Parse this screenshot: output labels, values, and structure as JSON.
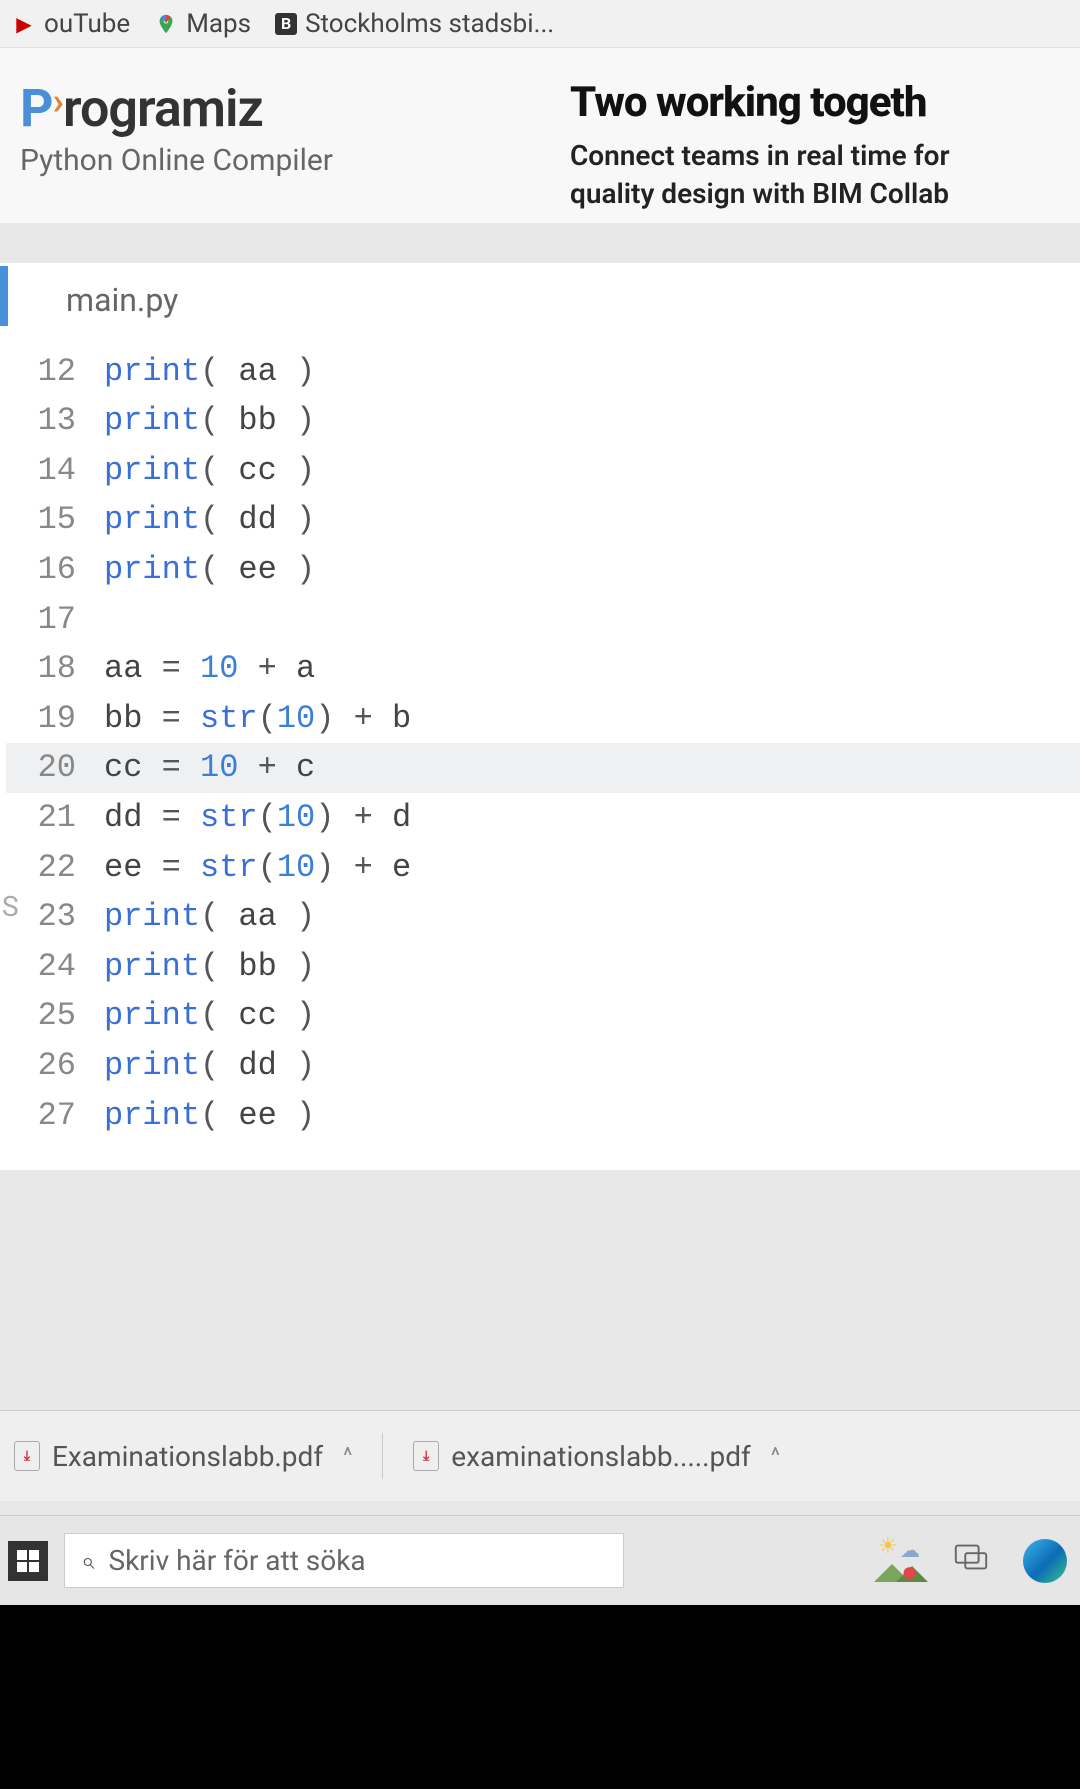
{
  "bookmarks": {
    "youtube_label": "ouTube",
    "maps_label": "Maps",
    "stockholms_label": "Stockholms stadsbi...",
    "stockholms_badge": "B"
  },
  "site": {
    "logo_rest": "rogramiz",
    "subtitle": "Python Online Compiler"
  },
  "ad": {
    "title": "Two working togeth",
    "line1": "Connect teams in real time for",
    "line2": "quality design with BIM Collab"
  },
  "editor": {
    "filename": "main.py",
    "lines": [
      {
        "n": "12",
        "tokens": [
          [
            "fn",
            "print"
          ],
          [
            "op",
            "( "
          ],
          [
            "var",
            "aa"
          ],
          [
            "op",
            " )"
          ]
        ]
      },
      {
        "n": "13",
        "tokens": [
          [
            "fn",
            "print"
          ],
          [
            "op",
            "( "
          ],
          [
            "var",
            "bb"
          ],
          [
            "op",
            " )"
          ]
        ]
      },
      {
        "n": "14",
        "tokens": [
          [
            "fn",
            "print"
          ],
          [
            "op",
            "( "
          ],
          [
            "var",
            "cc"
          ],
          [
            "op",
            " )"
          ]
        ]
      },
      {
        "n": "15",
        "tokens": [
          [
            "fn",
            "print"
          ],
          [
            "op",
            "( "
          ],
          [
            "var",
            "dd"
          ],
          [
            "op",
            " )"
          ]
        ]
      },
      {
        "n": "16",
        "tokens": [
          [
            "fn",
            "print"
          ],
          [
            "op",
            "( "
          ],
          [
            "var",
            "ee"
          ],
          [
            "op",
            " )"
          ]
        ]
      },
      {
        "n": "17",
        "tokens": []
      },
      {
        "n": "18",
        "tokens": [
          [
            "var",
            "aa "
          ],
          [
            "op",
            "= "
          ],
          [
            "num",
            "10"
          ],
          [
            "op",
            " + "
          ],
          [
            "var",
            "a"
          ]
        ]
      },
      {
        "n": "19",
        "tokens": [
          [
            "var",
            "bb "
          ],
          [
            "op",
            "= "
          ],
          [
            "fn",
            "str"
          ],
          [
            "op",
            "("
          ],
          [
            "num",
            "10"
          ],
          [
            "op",
            ") + "
          ],
          [
            "var",
            "b"
          ]
        ]
      },
      {
        "n": "20",
        "hl": true,
        "tokens": [
          [
            "var",
            "cc "
          ],
          [
            "op",
            "= "
          ],
          [
            "num",
            "10"
          ],
          [
            "op",
            " + "
          ],
          [
            "var",
            "c"
          ]
        ]
      },
      {
        "n": "21",
        "tokens": [
          [
            "var",
            "dd "
          ],
          [
            "op",
            "= "
          ],
          [
            "fn",
            "str"
          ],
          [
            "op",
            "("
          ],
          [
            "num",
            "10"
          ],
          [
            "op",
            ") + "
          ],
          [
            "var",
            "d"
          ]
        ]
      },
      {
        "n": "22",
        "tokens": [
          [
            "var",
            "ee "
          ],
          [
            "op",
            "= "
          ],
          [
            "fn",
            "str"
          ],
          [
            "op",
            "("
          ],
          [
            "num",
            "10"
          ],
          [
            "op",
            ") + "
          ],
          [
            "var",
            "e"
          ]
        ]
      },
      {
        "n": "23",
        "tokens": [
          [
            "fn",
            "print"
          ],
          [
            "op",
            "( "
          ],
          [
            "var",
            "aa"
          ],
          [
            "op",
            " )"
          ]
        ]
      },
      {
        "n": "24",
        "tokens": [
          [
            "fn",
            "print"
          ],
          [
            "op",
            "( "
          ],
          [
            "var",
            "bb"
          ],
          [
            "op",
            " )"
          ]
        ]
      },
      {
        "n": "25",
        "tokens": [
          [
            "fn",
            "print"
          ],
          [
            "op",
            "( "
          ],
          [
            "var",
            "cc"
          ],
          [
            "op",
            " )"
          ]
        ]
      },
      {
        "n": "26",
        "tokens": [
          [
            "fn",
            "print"
          ],
          [
            "op",
            "( "
          ],
          [
            "var",
            "dd"
          ],
          [
            "op",
            " )"
          ]
        ]
      },
      {
        "n": "27",
        "tokens": [
          [
            "fn",
            "print"
          ],
          [
            "op",
            "( "
          ],
          [
            "var",
            "ee"
          ],
          [
            "op",
            " )"
          ]
        ]
      }
    ]
  },
  "left_hints": {
    "s": "S"
  },
  "downloads": {
    "item1": "Examinationslabb.pdf",
    "item2": "examinationslabb.....pdf",
    "chevron": "^"
  },
  "taskbar": {
    "search_placeholder": "Skriv här för att söka"
  }
}
